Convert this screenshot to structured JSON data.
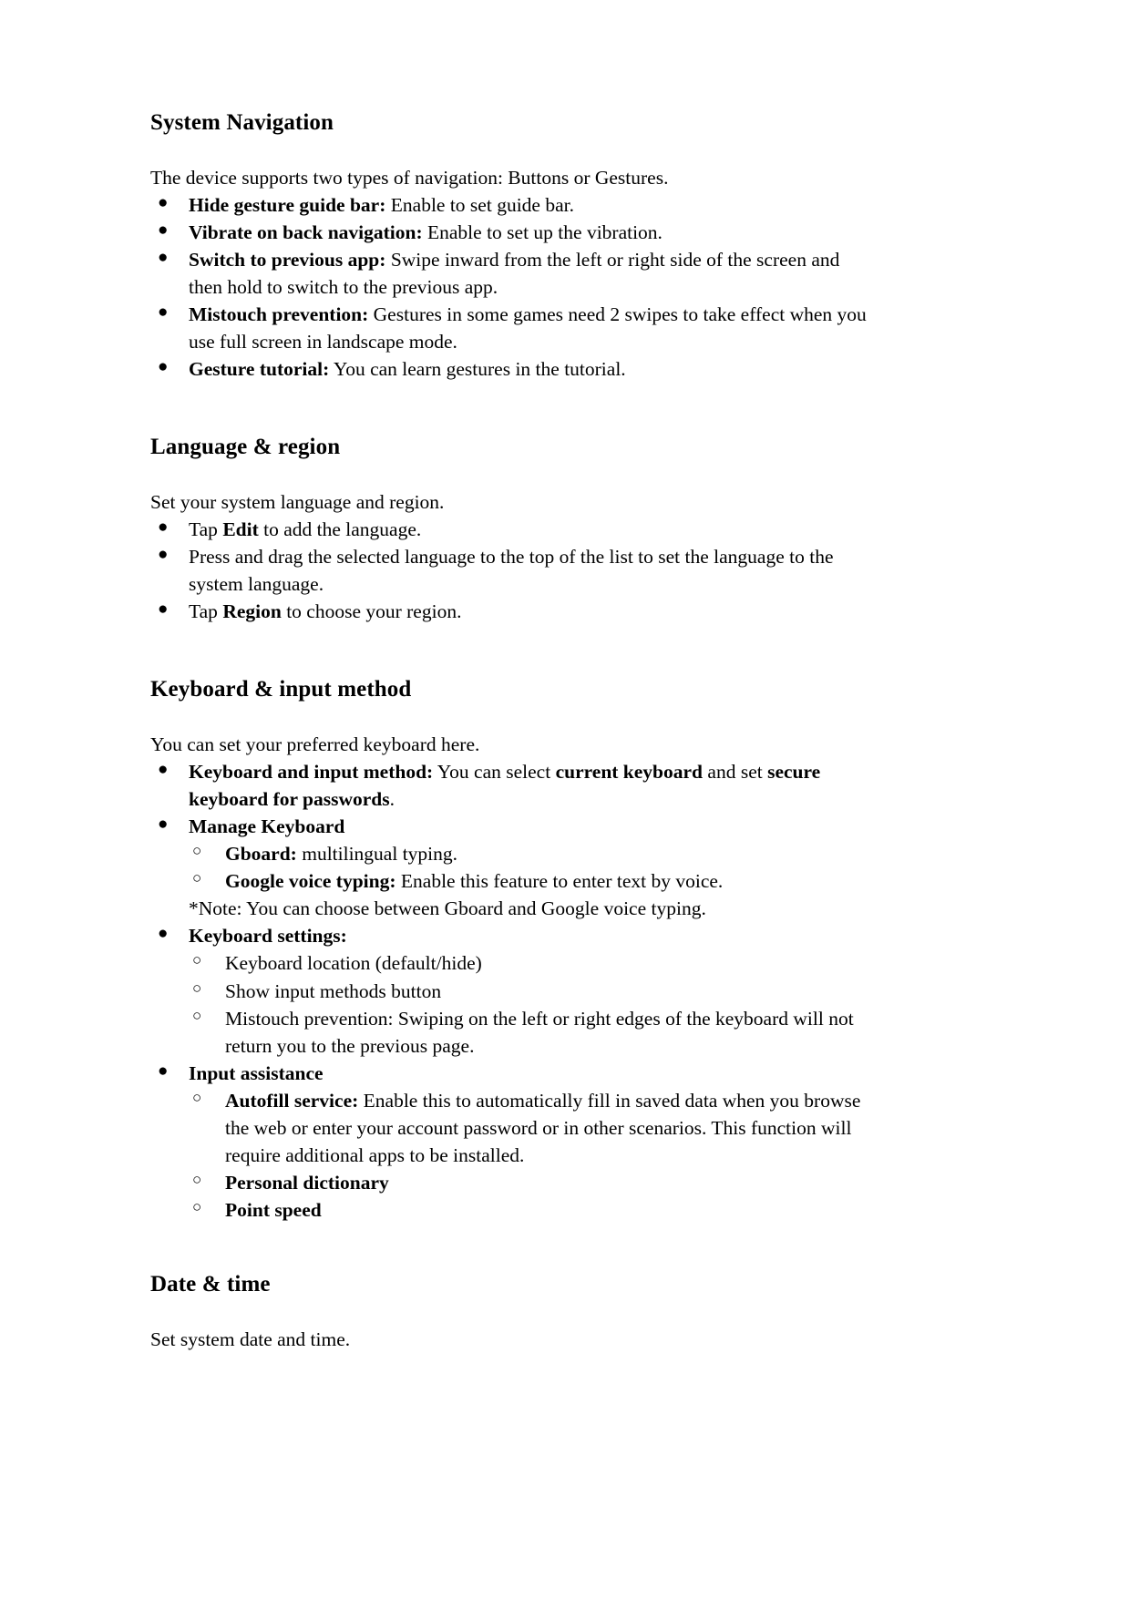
{
  "document": {
    "page_background": "#ffffff",
    "text_color": "#000000",
    "bullet_level1": "●",
    "bullet_level2": "○"
  },
  "sections": [
    {
      "heading": "System Navigation",
      "intro": "The device supports two types of navigation: Buttons or Gestures.",
      "items": [
        {
          "bold": "Hide gesture guide bar:",
          "rest": " Enable to set guide bar."
        },
        {
          "bold": "Vibrate on back navigation:",
          "rest": " Enable to set up the vibration."
        },
        {
          "bold": "Switch to previous app:",
          "rest": " Swipe inward from the left or right side of the screen and then hold to switch to the previous app."
        },
        {
          "bold": "Mistouch prevention:",
          "rest": " Gestures in some games need 2 swipes to take effect when you use full screen in landscape mode."
        },
        {
          "bold": "Gesture tutorial:",
          "rest": " You can learn gestures in the tutorial."
        }
      ]
    },
    {
      "heading": "Language & region",
      "intro": "Set your system language and region.",
      "items": [
        {
          "pre": "Tap ",
          "bold": "Edit",
          "rest": " to add the language."
        },
        {
          "pre": "",
          "bold": "",
          "rest": "Press and drag the selected language to the top of the list to set the language to the system language."
        },
        {
          "pre": "Tap ",
          "bold": "Region",
          "rest": " to choose your region."
        }
      ]
    },
    {
      "heading": "Keyboard & input method",
      "intro": "You can set your preferred keyboard here.",
      "items": [
        {
          "bold": "Keyboard and input method:",
          "rest_a": " You can select ",
          "bold_b": "current keyboard",
          "rest_b": " and set ",
          "bold_c": "keyboard for passwords",
          "bold_c_lead": "secure",
          "rest_c": "."
        },
        {
          "bold": "Manage Keyboard",
          "rest": "",
          "sub": [
            {
              "bold": "Gboard:",
              "rest": " multilingual typing."
            },
            {
              "bold": "Google voice typing:",
              "rest": " Enable this feature to enter text by voice."
            }
          ],
          "note": "*Note: You can choose between Gboard and Google voice typing."
        },
        {
          "bold": "Keyboard settings:",
          "rest": "",
          "sub": [
            {
              "bold": "",
              "rest": "Keyboard location (default/hide)"
            },
            {
              "bold": "",
              "rest": "Show input methods button"
            },
            {
              "bold": "",
              "rest": "Mistouch prevention: Swiping on the left or right edges of the keyboard will not return you to the previous page."
            }
          ]
        },
        {
          "bold": "Input assistance",
          "rest": "",
          "sub": [
            {
              "bold": "Autofill service:",
              "rest": " Enable this to automatically fill in saved data when you browse the web or enter your account password or in other scenarios. This function will require additional apps to be installed."
            },
            {
              "bold": "Personal dictionary",
              "rest": ""
            },
            {
              "bold": "Point speed",
              "rest": ""
            }
          ]
        }
      ]
    },
    {
      "heading": "Date & time",
      "intro": "Set system date and time.",
      "items": []
    }
  ]
}
